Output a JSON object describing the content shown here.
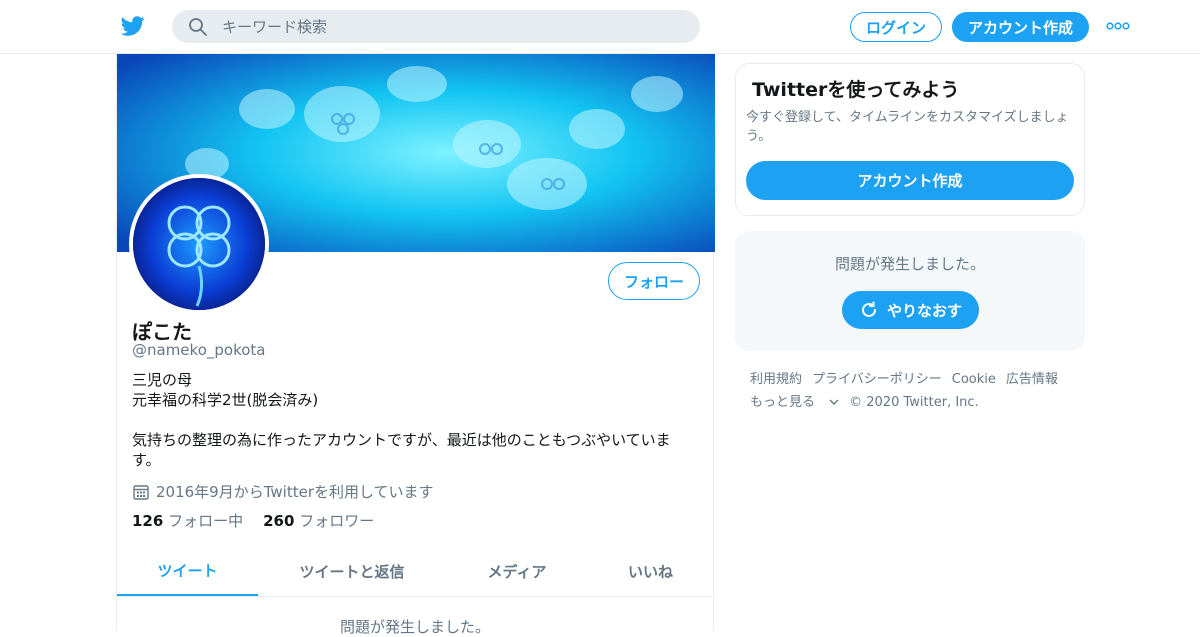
{
  "header": {
    "search_placeholder": "キーワード検索",
    "login_label": "ログイン",
    "signup_label": "アカウント作成"
  },
  "profile": {
    "follow_label": "フォロー",
    "name": "ぽこた",
    "handle": "@nameko_pokota",
    "bio_lines": [
      "三児の母",
      "元幸福の科学2世(脱会済み)",
      "",
      "気持ちの整理の為に作ったアカウントですが、最近は他のこともつぶやいていま",
      "す。"
    ],
    "joined": "2016年9月からTwitterを利用しています",
    "following_count": "126",
    "following_label": "フォロー中",
    "followers_count": "260",
    "followers_label": "フォロワー"
  },
  "tabs": [
    {
      "label": "ツイート",
      "active": true
    },
    {
      "label": "ツイートと返信",
      "active": false
    },
    {
      "label": "メディア",
      "active": false
    },
    {
      "label": "いいね",
      "active": false
    }
  ],
  "timeline_error": "問題が発生しました。",
  "sidebar": {
    "signup_card": {
      "title": "Twitterを使ってみよう",
      "description": "今すぐ登録して、タイムラインをカスタマイズしましょう。",
      "button_label": "アカウント作成"
    },
    "error_card": {
      "message": "問題が発生しました。",
      "retry_label": "やりなおす"
    },
    "footer": {
      "terms": "利用規約",
      "privacy": "プライバシーポリシー",
      "cookie": "Cookie",
      "ads": "広告情報",
      "more": "もっと見る",
      "copyright": "© 2020 Twitter, Inc."
    }
  },
  "colors": {
    "accent": "#1da1f2",
    "secondary_text": "#657786",
    "border": "#e6ecf0",
    "banner": "#00b8f0"
  }
}
